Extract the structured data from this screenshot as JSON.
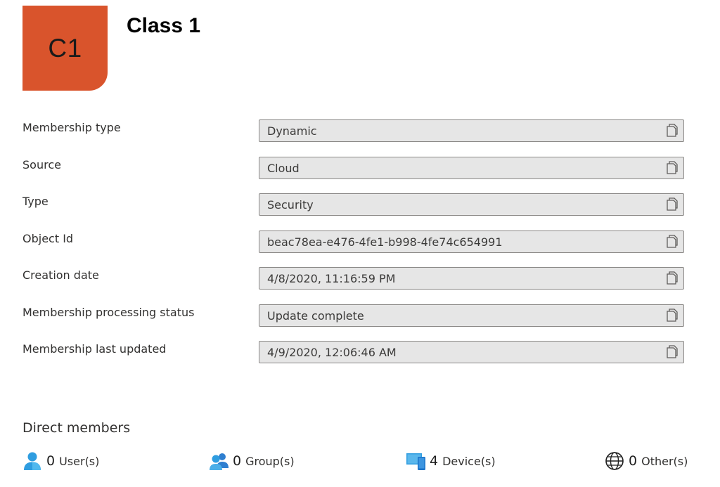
{
  "header": {
    "avatar_initials": "C1",
    "avatar_color": "#d9542c",
    "title": "Class 1"
  },
  "properties": [
    {
      "label": "Membership type",
      "value": "Dynamic"
    },
    {
      "label": "Source",
      "value": "Cloud"
    },
    {
      "label": "Type",
      "value": "Security"
    },
    {
      "label": "Object Id",
      "value": "beac78ea-e476-4fe1-b998-4fe74c654991"
    },
    {
      "label": "Creation date",
      "value": "4/8/2020, 11:16:59 PM"
    },
    {
      "label": "Membership processing status",
      "value": "Update complete"
    },
    {
      "label": "Membership last updated",
      "value": "4/9/2020, 12:06:46 AM"
    }
  ],
  "copy_icon": "copy-icon",
  "direct_members": {
    "heading": "Direct members",
    "stats": [
      {
        "icon": "user-icon",
        "count": "0",
        "label": "User(s)"
      },
      {
        "icon": "group-icon",
        "count": "0",
        "label": "Group(s)"
      },
      {
        "icon": "device-icon",
        "count": "4",
        "label": "Device(s)"
      },
      {
        "icon": "globe-icon",
        "count": "0",
        "label": "Other(s)"
      }
    ]
  }
}
